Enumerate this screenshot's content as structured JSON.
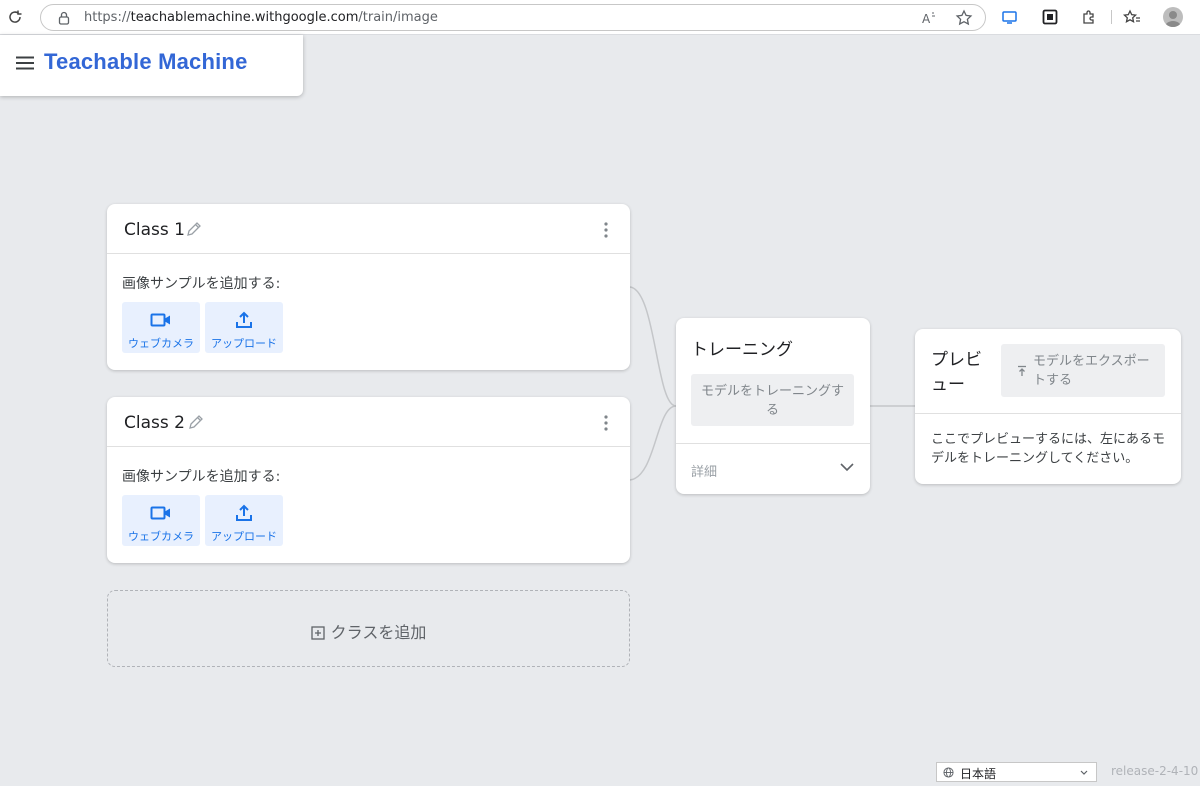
{
  "browser": {
    "url_scheme": "https://",
    "url_host": "teachablemachine.withgoogle.com",
    "url_path": "/train/image"
  },
  "header": {
    "title": "Teachable Machine"
  },
  "classes": [
    {
      "name": "Class 1",
      "add_samples_label": "画像サンプルを追加する:",
      "webcam_label": "ウェブカメラ",
      "upload_label": "アップロード"
    },
    {
      "name": "Class 2",
      "add_samples_label": "画像サンプルを追加する:",
      "webcam_label": "ウェブカメラ",
      "upload_label": "アップロード"
    }
  ],
  "add_class": {
    "label": "クラスを追加"
  },
  "training": {
    "title": "トレーニング",
    "train_button": "モデルをトレーニングする",
    "details_label": "詳細"
  },
  "preview": {
    "title": "プレビュー",
    "export_button": "モデルをエクスポートする",
    "message": "ここでプレビューするには、左にあるモデルをトレーニングしてください。"
  },
  "footer": {
    "language": "日本語",
    "release": "release-2-4-10"
  },
  "colors": {
    "accent": "#3367d6",
    "button_tint": "#e8f0fe",
    "background": "#e8eaed"
  }
}
